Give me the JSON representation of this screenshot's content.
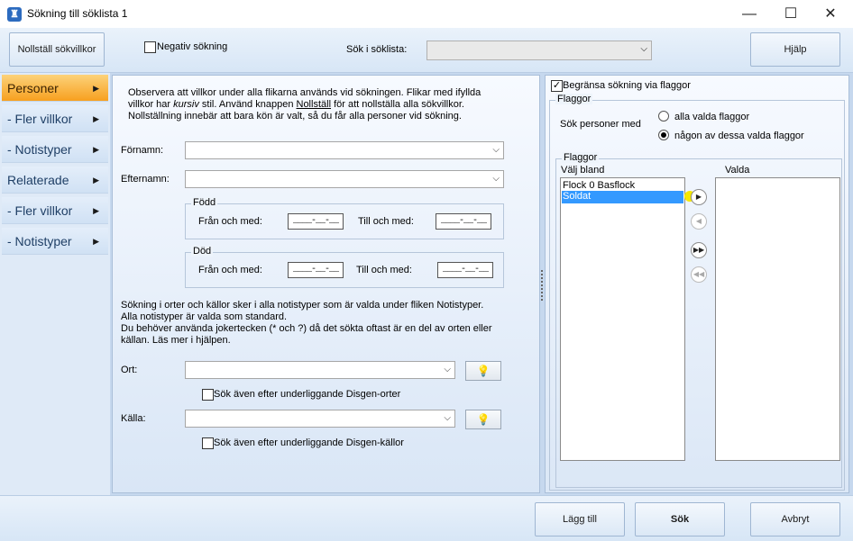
{
  "window": {
    "title": "Sökning till söklista 1",
    "icon": "app-icon",
    "controls": {
      "minimize": "—",
      "maximize": "☐",
      "close": "✕"
    }
  },
  "toolbar": {
    "reset_label": "Nollställ sökvillkor",
    "negative_label": "Negativ sökning",
    "negative_checked": false,
    "search_in_label": "Sök i söklista:",
    "search_in_value": "",
    "help_label": "Hjälp"
  },
  "sidebar": {
    "items": [
      {
        "label": "Personer",
        "active": true
      },
      {
        "label": "- Fler villkor",
        "active": false
      },
      {
        "label": "- Notistyper",
        "active": false
      },
      {
        "label": "Relaterade",
        "active": false
      },
      {
        "label": "- Fler villkor",
        "active": false
      },
      {
        "label": "- Notistyper",
        "active": false
      }
    ]
  },
  "left": {
    "info_line1": "Observera att villkor under alla flikarna används vid sökningen. Flikar med ifyllda",
    "info_line2a": "villkor har ",
    "info_line2_kursiv": "kursiv",
    "info_line2b": " stil. Använd knappen ",
    "info_line2_nollstall": "Nollställ",
    "info_line2c": " för att nollställa alla sökvillkor.",
    "info_line3": "Nollställning innebär att bara kön är valt, så du får alla personer vid sökning.",
    "fornamn_label": "Förnamn:",
    "fornamn_value": "",
    "efternamn_label": "Efternamn:",
    "efternamn_value": "",
    "fodd": {
      "title": "Född",
      "from_label": "Från och med:",
      "from_value": "____-__-__",
      "to_label": "Till och med:",
      "to_value": "____-__-__"
    },
    "dod": {
      "title": "Död",
      "from_label": "Från och med:",
      "from_value": "____-__-__",
      "to_label": "Till och med:",
      "to_value": "____-__-__"
    },
    "note_line1": "Sökning i orter och källor sker i alla notistyper som är valda under fliken Notistyper.",
    "note_line2": "Alla notistyper är valda som standard.",
    "note_line3": "Du behöver använda jokertecken (* och ?) då det sökta oftast är en del av orten eller",
    "note_line4": "källan. Läs mer i hjälpen.",
    "ort_label": "Ort:",
    "ort_value": "",
    "ort_sub_label": "Sök även efter underliggande Disgen-orter",
    "kalla_label": "Källa:",
    "kalla_value": "",
    "kalla_sub_label": "Sök även efter underliggande Disgen-källor"
  },
  "right": {
    "limit_label": "Begränsa sökning via flaggor",
    "limit_checked": true,
    "flaggor_group": "Flaggor",
    "search_persons_label": "Sök personer med",
    "radio_all": "alla valda flaggor",
    "radio_any": "någon av dessa valda flaggor",
    "flaggor_inner": "Flaggor",
    "choose_label": "Välj bland",
    "selected_label": "Valda",
    "available": [
      {
        "label": "Flock 0 Basflock",
        "selected": false
      },
      {
        "label": "Soldat",
        "selected": true
      }
    ],
    "chosen": []
  },
  "bottom": {
    "add_label": "Lägg till",
    "search_label": "Sök",
    "cancel_label": "Avbryt"
  },
  "colors": {
    "accent_orange": "#f7a01f",
    "selection_blue": "#3399ff",
    "highlight_yellow": "#f5e800"
  }
}
